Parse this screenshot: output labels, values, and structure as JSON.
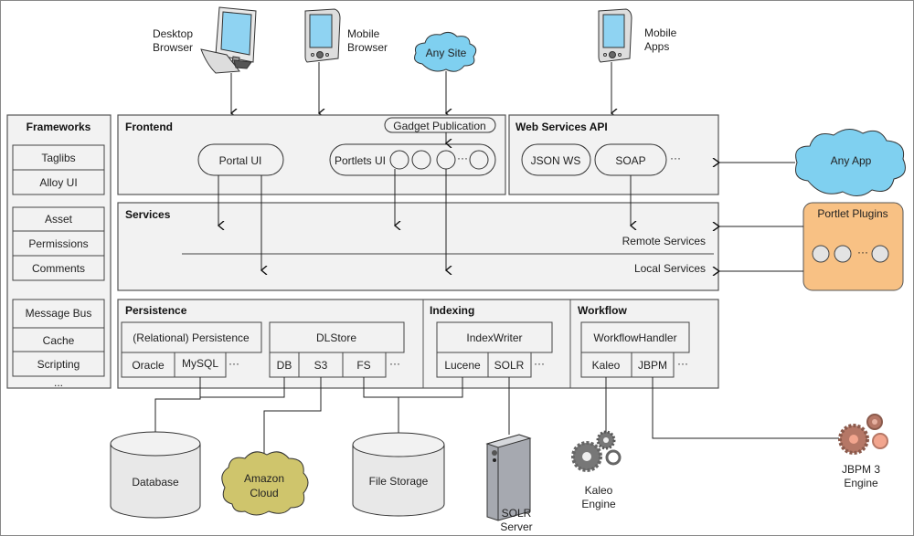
{
  "colors": {
    "cloud_blue": "#7fd0f0",
    "amazon_cloud": "#cfc56c",
    "portlet_plugins": "#f8c184",
    "panel": "#f2f2f2",
    "jbpm_gear": "#b57766",
    "kaleo_gear": "#777777"
  },
  "clients": {
    "desktop": [
      "Desktop",
      "Browser"
    ],
    "mobile_browser": [
      "Mobile",
      "Browser"
    ],
    "any_site": "Any Site",
    "mobile_apps": [
      "Mobile",
      "Apps"
    ]
  },
  "frameworks": {
    "title": "Frameworks",
    "items": [
      "Taglibs",
      "Alloy UI",
      "Asset",
      "Permissions",
      "Comments",
      "Message Bus",
      "Cache",
      "Scripting"
    ],
    "more": "..."
  },
  "frontend": {
    "title": "Frontend",
    "gadget": "Gadget Publication",
    "portal_ui": "Portal UI",
    "portlets_ui": "Portlets UI",
    "more": "···"
  },
  "webservices": {
    "title": "Web Services API",
    "json": "JSON WS",
    "soap": "SOAP",
    "more": "···"
  },
  "any_app": "Any App",
  "portlet_plugins": {
    "title": "Portlet Plugins",
    "more": "···"
  },
  "services": {
    "title": "Services",
    "remote": "Remote Services",
    "local": "Local Services"
  },
  "persistence": {
    "title": "Persistence",
    "relational": "(Relational) Persistence",
    "oracle": "Oracle",
    "mysql": "MySQL",
    "dlstore": "DLStore",
    "db": "DB",
    "s3": "S3",
    "fs": "FS",
    "more": "···"
  },
  "indexing": {
    "title": "Indexing",
    "writer": "IndexWriter",
    "lucene": "Lucene",
    "solr": "SOLR",
    "more": "···"
  },
  "workflow": {
    "title": "Workflow",
    "handler": "WorkflowHandler",
    "kaleo": "Kaleo",
    "jbpm": "JBPM",
    "more": "···"
  },
  "bottom": {
    "database": "Database",
    "amazon": [
      "Amazon",
      "Cloud"
    ],
    "file_storage": "File Storage",
    "solr_server": [
      "SOLR",
      "Server"
    ],
    "kaleo_engine": [
      "Kaleo",
      "Engine"
    ],
    "jbpm_engine": [
      "JBPM 3",
      "Engine"
    ]
  }
}
